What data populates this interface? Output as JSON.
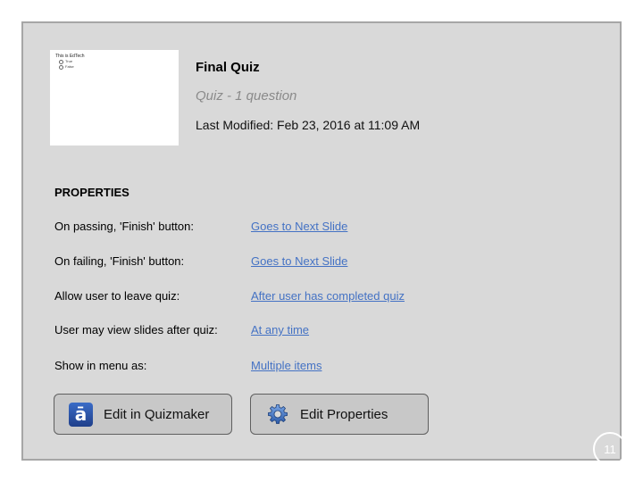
{
  "thumbnail": {
    "title": "This is EdTech",
    "options": [
      "True",
      "False"
    ]
  },
  "quiz": {
    "title": "Final Quiz",
    "subtitle": "Quiz - 1 question",
    "last_modified": "Last Modified: Feb 23, 2016 at 11:09 AM"
  },
  "properties": {
    "header": "PROPERTIES",
    "rows": [
      {
        "label": "On passing, 'Finish' button:",
        "value": "Goes to Next Slide"
      },
      {
        "label": "On failing, 'Finish' button:",
        "value": "Goes to Next Slide"
      },
      {
        "label": "Allow user to leave quiz:",
        "value": "After user has completed quiz"
      },
      {
        "label": "User may view slides after quiz:",
        "value": "At any time"
      },
      {
        "label": "Show in menu as:",
        "value": "Multiple items"
      }
    ]
  },
  "buttons": {
    "edit_quizmaker": "Edit in Quizmaker",
    "edit_properties": "Edit Properties"
  },
  "icons": {
    "quizmaker": "quizmaker-icon",
    "properties": "gear-icon"
  },
  "page_number": "11",
  "colors": {
    "panel": "#d9d9d9",
    "link": "#4472c4",
    "button": "#c8c8c8"
  }
}
